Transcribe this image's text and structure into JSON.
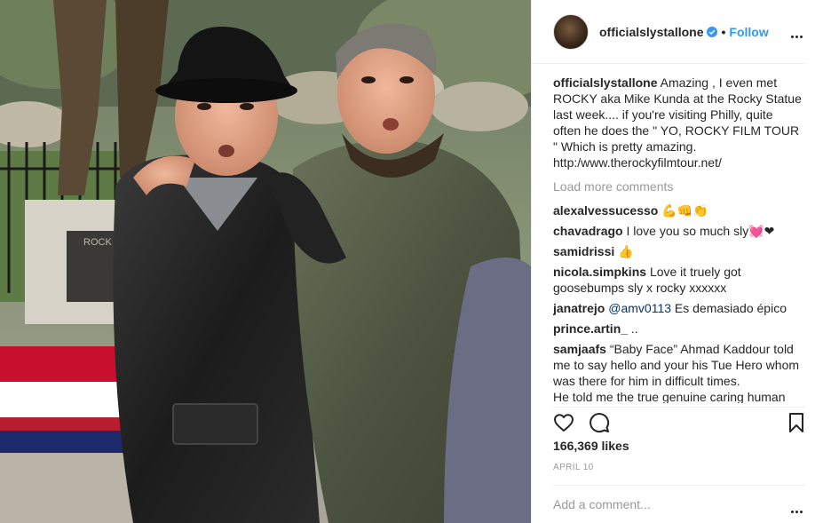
{
  "post": {
    "username": "officialslystallone",
    "follow_label": "Follow",
    "separator": "•",
    "caption_user": "officialslystallone",
    "caption_lines": [
      "Amazing , I even met",
      "ROCKY aka Mike Kunda at the Rocky Statue",
      "last week.... if you're visiting Philly, quite",
      "often he does the \" YO, ROCKY FILM TOUR",
      "\" Which is pretty amazing.",
      "http:/www.therockyfilmtour.net/"
    ],
    "load_more": "Load more comments",
    "likes": "166,369 likes",
    "date": "APRIL 10",
    "add_comment_placeholder": "Add a comment..."
  },
  "comments": [
    {
      "user": "alexalvessucesso",
      "text": "💪👊👏"
    },
    {
      "user": "chavadrago",
      "text": "I love you so much sly💓❤"
    },
    {
      "user": "samidrissi",
      "text": "👍"
    },
    {
      "user": "nicola.simpkins",
      "text": "Love it truely got goosebumps sly x rocky xxxxxx"
    },
    {
      "user": "janatrejo",
      "mention": "@amv0113",
      "text": " Es demasiado épico"
    },
    {
      "user": "prince.artin_",
      "text": ".."
    },
    {
      "user": "samjaafs",
      "text": "“Baby Face” Ahmad Kaddour told me to say hello and your his Tue Hero whom was there for him in difficult times.",
      "overflow": "He told me the true genuine caring human"
    }
  ],
  "icons": {
    "verified": "verified-badge-icon",
    "like": "heart-icon",
    "comment": "comment-bubble-icon",
    "save": "bookmark-icon",
    "more": "more-options-icon"
  },
  "colors": {
    "link": "#3897f0",
    "verified": "#3897f0",
    "muted": "#999999",
    "text": "#262626"
  },
  "photo": {
    "statue_plaque_text": "ROCK"
  }
}
